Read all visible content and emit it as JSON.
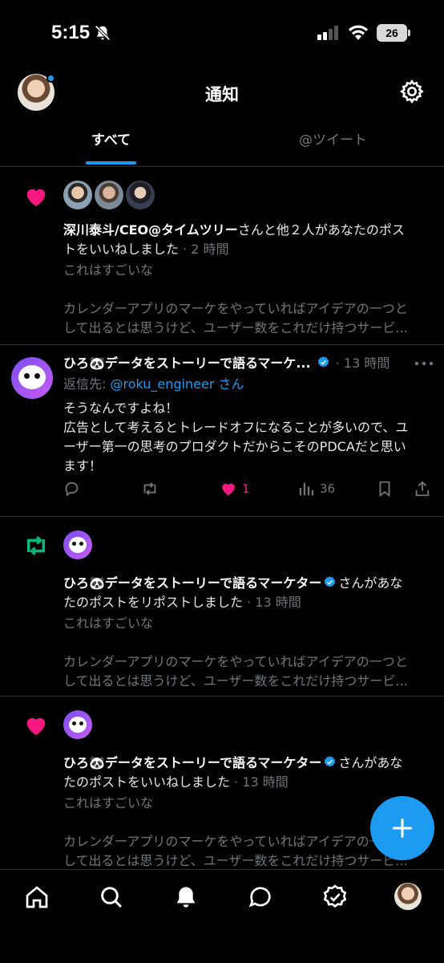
{
  "status_bar": {
    "time": "5:15",
    "battery": "26"
  },
  "header": {
    "title": "通知"
  },
  "tabs": [
    {
      "label": "すべて",
      "active": true
    },
    {
      "label": "@ツイート",
      "active": false
    }
  ],
  "notifications": [
    {
      "type": "like",
      "actor": "深川泰斗/CEO@タイムツリー",
      "text_line1_rest": "さんと他２人があなたのポス",
      "text_line2": "トをいいねしました",
      "time": " · 2 時間",
      "preview_line1": "これはすごいな",
      "preview_line2": "カレンダーアプリのマーケをやっていればアイデアの一つと",
      "preview_line3": "して出るとは思うけど、ユーザー数をこれだけ持つサービ..."
    },
    {
      "type": "retweet",
      "actor": "ひろ🐼データをストーリーで語るマーケター",
      "text_line1_rest": "さんがあな",
      "text_line2": "たのポストをリポストしました",
      "time": " · 13 時間",
      "preview_line1": "これはすごいな",
      "preview_line2": "カレンダーアプリのマーケをやっていればアイデアの一つと",
      "preview_line3": "して出るとは思うけど、ユーザー数をこれだけ持つサービ..."
    },
    {
      "type": "like",
      "actor": "ひろ🐼データをストーリーで語るマーケター",
      "text_line1_rest": "さんがあな",
      "text_line2": "たのポストをいいねしました",
      "time": " · 13 時間",
      "preview_line1": "これはすごいな",
      "preview_line2": "カレンダーアプリのマーケをやっていればアイデアの一つと",
      "preview_line3": "して出るとは思うけど、ユーザー数をこれだけ持つサービ..."
    }
  ],
  "reply_tweet": {
    "name": "ひろ🐼データをストーリーで語るマーケ...",
    "time": "· 13 時間",
    "reply_prefix": "返信先: ",
    "reply_handle": "@roku_engineer",
    "reply_suffix": " さん",
    "body_line1": "そうなんですよね！",
    "body_line2": "広告として考えるとトレードオフになることが多いので、ユ",
    "body_line3": "ーザー第一の思考のプロダクトだからこそのPDCAだと思い",
    "body_line4": "ます！",
    "like_count": "1",
    "view_count": "36"
  },
  "icons": {
    "tab_bar": [
      "home-icon",
      "search-icon",
      "bell-icon",
      "messages-icon",
      "verified-icon",
      "profile-avatar"
    ],
    "fab": "plus-icon"
  },
  "colors": {
    "accent": "#1d9bf0",
    "like": "#f91880",
    "retweet": "#00ba7c",
    "background": "#000000"
  }
}
